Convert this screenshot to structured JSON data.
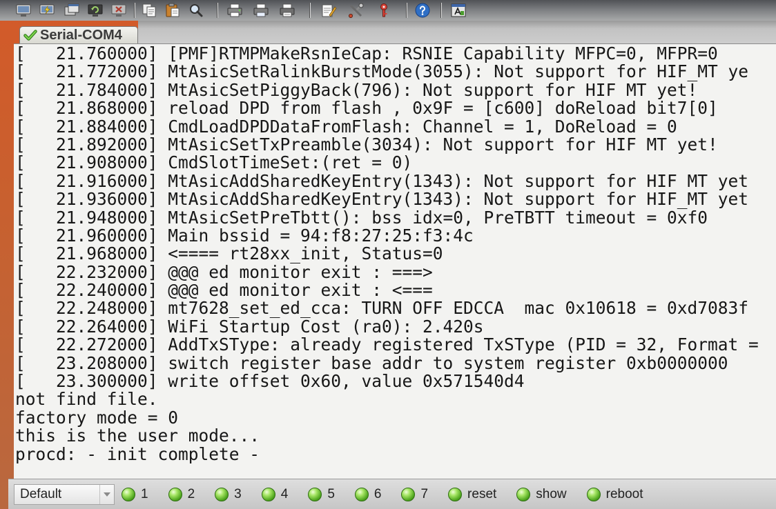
{
  "toolbar": {
    "icons": [
      "connect-icon",
      "quick-connect-icon",
      "connect-in-tab-icon",
      "reconnect-icon",
      "disconnect-icon",
      "copy-icon",
      "paste-icon",
      "find-icon",
      "print-setup-icon",
      "print-selection-icon",
      "print-icon",
      "session-options-icon",
      "global-options-icon",
      "key-icon",
      "help-icon",
      "about-icon"
    ]
  },
  "tabs": [
    {
      "label": "Serial-COM4",
      "icon": "check-icon",
      "active": true
    }
  ],
  "terminal": {
    "lines": [
      "[   21.760000] [PMF]RTMPMakeRsnIeCap: RSNIE Capability MFPC=0, MFPR=0",
      "[   21.772000] MtAsicSetRalinkBurstMode(3055): Not support for HIF_MT ye",
      "[   21.784000] MtAsicSetPiggyBack(796): Not support for HIF_MT yet!",
      "[   21.868000] reload DPD from flash , 0x9F = [c600] doReload bit7[0]",
      "[   21.884000] CmdLoadDPDDataFromFlash: Channel = 1, DoReload = 0",
      "[   21.892000] MtAsicSetTxPreamble(3034): Not support for HIF_MT yet!",
      "[   21.908000] CmdSlotTimeSet:(ret = 0)",
      "[   21.916000] MtAsicAddSharedKeyEntry(1343): Not support for HIF_MT yet",
      "[   21.936000] MtAsicAddSharedKeyEntry(1343): Not support for HIF_MT yet",
      "[   21.948000] MtAsicSetPreTbtt(): bss_idx=0, PreTBTT timeout = 0xf0",
      "[   21.960000] Main bssid = 94:f8:27:25:f3:4c",
      "[   21.968000] <==== rt28xx_init, Status=0",
      "[   22.232000] @@@ ed_monitor_exit : ===>",
      "[   22.240000] @@@ ed_monitor_exit : <===",
      "[   22.248000] mt7628_set_ed_cca: TURN OFF EDCCA  mac 0x10618 = 0xd7083f",
      "[   22.264000] WiFi Startup Cost (ra0): 2.420s",
      "[   22.272000] AddTxSType: already registered TxSType (PID = 32, Format =",
      "[   23.208000] switch register base addr to system register 0xb0000000",
      "[   23.300000] write offset 0x60, value 0x571540d4",
      "not find file.",
      "factory_mode = 0",
      "this is the user mode...",
      "procd: - init complete -"
    ]
  },
  "button_bar": {
    "session": {
      "value": "Default",
      "icon": "chevron-down-icon"
    },
    "buttons": [
      {
        "label": "1",
        "icon": "green-circle-icon"
      },
      {
        "label": "2",
        "icon": "green-circle-icon"
      },
      {
        "label": "3",
        "icon": "green-circle-icon"
      },
      {
        "label": "4",
        "icon": "green-circle-icon"
      },
      {
        "label": "5",
        "icon": "green-circle-icon"
      },
      {
        "label": "6",
        "icon": "green-circle-icon"
      },
      {
        "label": "7",
        "icon": "green-circle-icon"
      },
      {
        "label": "reset",
        "icon": "green-circle-icon"
      },
      {
        "label": "show",
        "icon": "green-circle-icon"
      },
      {
        "label": "reboot",
        "icon": "green-circle-icon"
      }
    ]
  },
  "colors": {
    "window_frame": "#d35a29",
    "terminal_background": "#f3f3f1",
    "terminal_text": "#171717",
    "button_icon": "#4ea51d",
    "tab_check": "#2e8b1d"
  }
}
